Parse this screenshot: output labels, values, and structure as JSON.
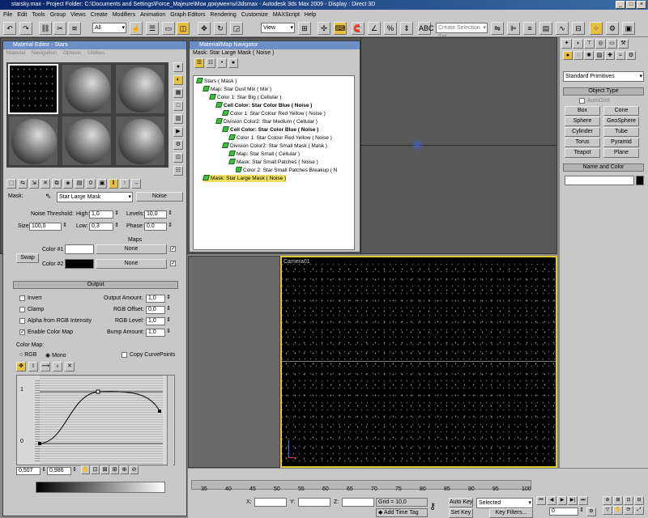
{
  "title": "starsky.max    - Project Folder: C:\\Documents and Settings\\Force_Majeure\\Мои документы\\3dsmax     - Autodesk 3ds Max 2009     - Display : Direct 3D",
  "menu": [
    "File",
    "Edit",
    "Tools",
    "Group",
    "Views",
    "Create",
    "Modifiers",
    "Animation",
    "Graph Editors",
    "Rendering",
    "Customize",
    "MAXScript",
    "Help"
  ],
  "toolbar": {
    "filter_all": "All",
    "view": "View",
    "selection_set": "Create Selection Set"
  },
  "material_editor": {
    "title": "Material Editor - Stars",
    "menu": [
      "Material",
      "Navigation",
      "Options",
      "Utilities"
    ],
    "mask_label": "Mask:",
    "mask_name": "Star Large Mask",
    "map_type": "Noise",
    "noise": {
      "threshold_label": "Noise Threshold:",
      "high_label": "High:",
      "high": "1,0",
      "levels_label": "Levels:",
      "levels": "10,0",
      "size_label": "Size:",
      "size": "100,0",
      "low_label": "Low:",
      "low": "0,3",
      "phase_label": "Phase:",
      "phase": "0,0",
      "maps_label": "Maps",
      "color1_label": "Color #1",
      "color2_label": "Color #2",
      "swap_label": "Swap",
      "none_label": "None"
    },
    "output": {
      "header": "Output",
      "invert": "Invert",
      "clamp": "Clamp",
      "alpha_from_rgb": "Alpha from RGB Intensity",
      "enable_color_map": "Enable Color Map",
      "output_amount_label": "Output Amount:",
      "output_amount": "1,0",
      "rgb_offset_label": "RGB Offset:",
      "rgb_offset": "0,0",
      "rgb_level_label": "RGB Level:",
      "rgb_level": "1,0",
      "bump_amount_label": "Bump Amount:",
      "bump_amount": "1,0",
      "color_map_label": "Color Map:",
      "rgb_radio": "RGB",
      "mono_radio": "Mono",
      "copy_curve": "Copy CurvePoints",
      "curve_top_label": "1",
      "curve_bottom_label": "0",
      "coord_x": "0,507",
      "coord_y": "0,986"
    }
  },
  "navigator": {
    "title": "Material/Map Navigator",
    "current": "Mask: Star Large Mask  ( Noise )",
    "tree": [
      {
        "text": "Stars  ( Mask )",
        "bold": false,
        "sel": false
      },
      {
        "text": "Map: Star Dust Mix  ( Mix )",
        "bold": false,
        "sel": false
      },
      {
        "text": "Color 1: Star Big  ( Cellular )",
        "bold": false,
        "sel": false
      },
      {
        "text": "Cell Color: Star Color Blue  ( Noise )",
        "bold": true,
        "sel": false
      },
      {
        "text": "Color 1: Star Colour Red Yellow  ( Noise )",
        "bold": false,
        "sel": false
      },
      {
        "text": "Division Color2: Star Medium  ( Cellular )",
        "bold": false,
        "sel": false
      },
      {
        "text": "Cell Color: Star Color Blue  ( Noise )",
        "bold": true,
        "sel": false
      },
      {
        "text": "Color 1: Star Colour Red Yellow  ( Noise )",
        "bold": false,
        "sel": false
      },
      {
        "text": "Division Color2: Star Small Mask  ( Mask )",
        "bold": false,
        "sel": false
      },
      {
        "text": "Map: Star Small  ( Cellular )",
        "bold": false,
        "sel": false
      },
      {
        "text": "Mask: Star Small Patches  ( Noise )",
        "bold": false,
        "sel": false
      },
      {
        "text": "Color 2: Star Small Patches Breakup  ( N",
        "bold": false,
        "sel": false
      },
      {
        "text": "Mask: Star Large Mask  ( Noise )",
        "bold": false,
        "sel": true
      }
    ]
  },
  "viewport": {
    "camera_label": "Camera01"
  },
  "command_panel": {
    "category": "Standard Primitives",
    "object_type": "Object Type",
    "autogrid": "AutoGrid",
    "buttons": [
      "Box",
      "Cone",
      "Sphere",
      "GeoSphere",
      "Cylinder",
      "Tube",
      "Torus",
      "Pyramid",
      "Teapot",
      "Plane"
    ],
    "name_and_color": "Name and Color"
  },
  "timeline": {
    "ticks": [
      "35",
      "40",
      "45",
      "50",
      "55",
      "60",
      "65",
      "70",
      "75",
      "80",
      "85",
      "90",
      "95",
      "100"
    ],
    "x_label": "X:",
    "y_label": "Y:",
    "z_label": "Z:",
    "grid": "Grid = 10,0",
    "add_time_tag": "Add Time Tag",
    "auto_key": "Auto Key",
    "set_key": "Set Key",
    "selected": "Selected",
    "key_filters": "Key Filters...",
    "frame": "0"
  }
}
